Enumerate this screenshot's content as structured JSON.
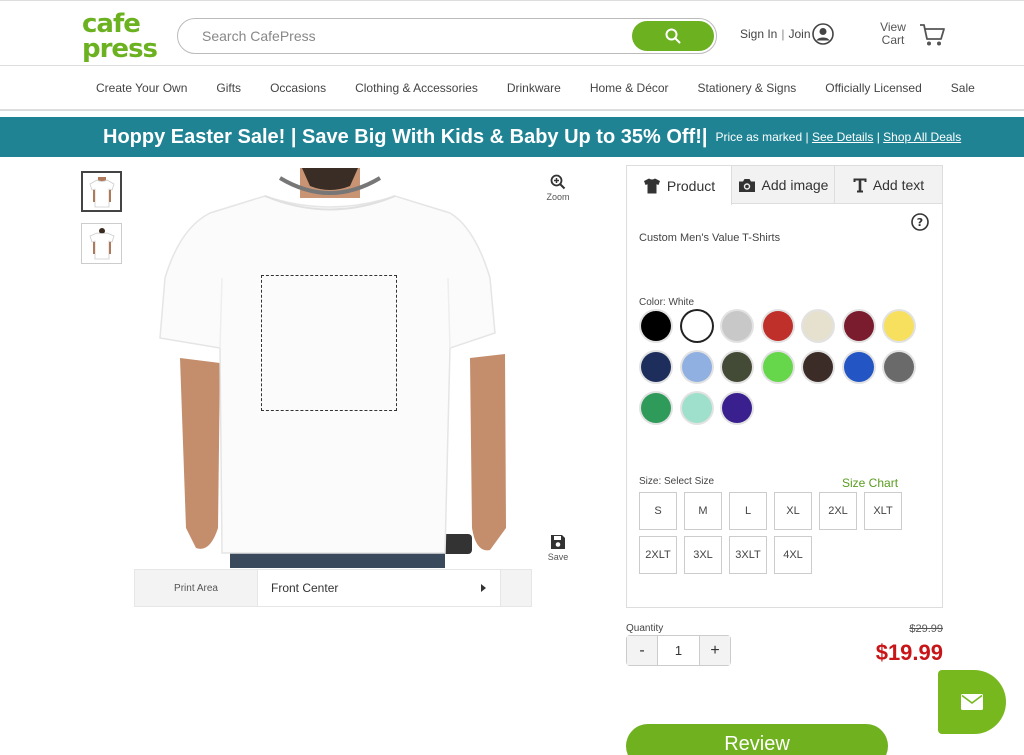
{
  "header": {
    "logo_text": "cafe press",
    "search_placeholder": "Search CafePress",
    "sign_in": "Sign In",
    "separator": "|",
    "join": "Join",
    "view_cart_line1": "View",
    "view_cart_line2": "Cart"
  },
  "nav": {
    "items": [
      "Create Your Own",
      "Gifts",
      "Occasions",
      "Clothing & Accessories",
      "Drinkware",
      "Home & Décor",
      "Stationery & Signs",
      "Officially Licensed",
      "Sale"
    ]
  },
  "promo": {
    "main": "Hoppy Easter Sale! | Save Big With Kids & Baby Up to 35% Off!|",
    "price_note": "Price as marked",
    "sep": "|",
    "details_link": "See Details",
    "shop_link": "Shop All Deals"
  },
  "image_tools": {
    "zoom_label": "Zoom",
    "save_label": "Save"
  },
  "print_area": {
    "label": "Print Area",
    "value": "Front Center"
  },
  "panel": {
    "tabs": [
      "Product",
      "Add image",
      "Add text"
    ],
    "product_name": "Custom Men's Value T-Shirts",
    "color_label": "Color:  White",
    "colors": [
      "#000000",
      "#ffffff",
      "#c8c8c8",
      "#c0302b",
      "#e6e1cf",
      "#7a1c2e",
      "#f6e05e",
      "#1e2e5c",
      "#8fb0e0",
      "#434a36",
      "#66d64a",
      "#3c2c28",
      "#2356c4",
      "#6a6a6a",
      "#2e9b5a",
      "#9ee0cc",
      "#3a1f8f"
    ],
    "selected_color_index": 1,
    "size_label": "Size:  Select Size",
    "size_chart": "Size Chart",
    "sizes": [
      "S",
      "M",
      "L",
      "XL",
      "2XL",
      "XLT",
      "2XLT",
      "3XL",
      "3XLT",
      "4XL"
    ]
  },
  "purchase": {
    "quantity_label": "Quantity",
    "minus": "-",
    "plus": "+",
    "quantity": "1",
    "old_price": "$29.99",
    "price": "$19.99",
    "review_button": "Review"
  },
  "colors_theme": {
    "brand_green": "#6bb120",
    "promo_teal": "#1f8394",
    "price_red": "#c81517"
  }
}
